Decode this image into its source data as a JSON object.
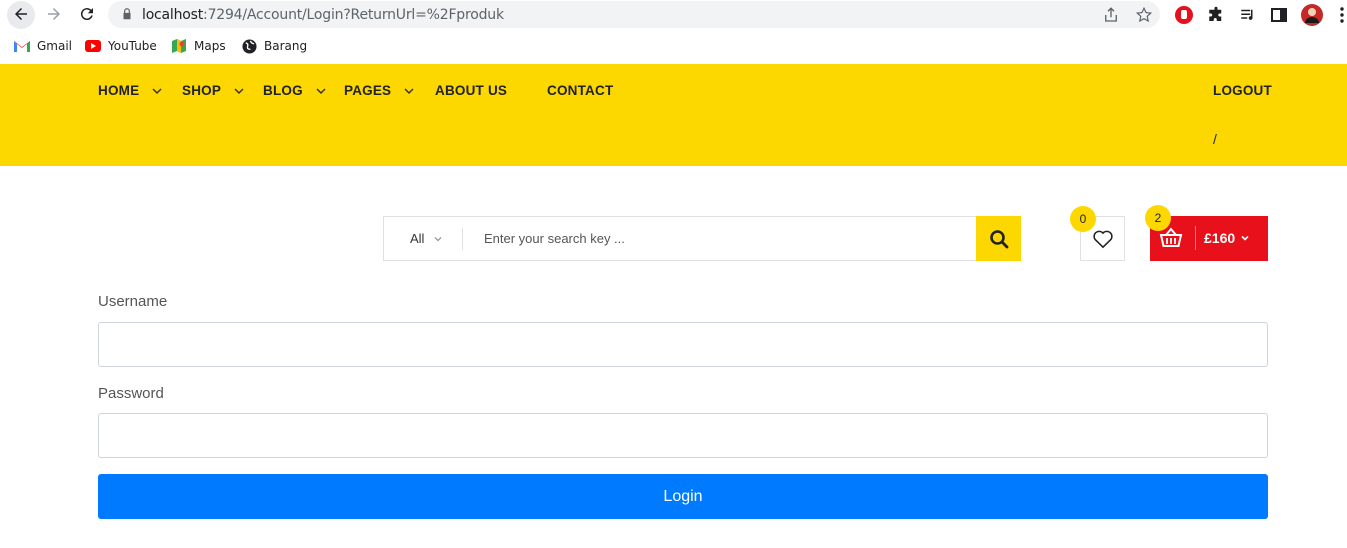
{
  "browser": {
    "url_host": "localhost",
    "url_rest": ":7294/Account/Login?ReturnUrl=%2Fproduk",
    "bookmarks": [
      {
        "label": "Gmail",
        "icon": "gmail-icon"
      },
      {
        "label": "YouTube",
        "icon": "youtube-icon"
      },
      {
        "label": "Maps",
        "icon": "maps-icon"
      },
      {
        "label": "Barang",
        "icon": "globe-icon"
      }
    ]
  },
  "nav": {
    "items": [
      {
        "label": "HOME",
        "dropdown": true
      },
      {
        "label": "SHOP",
        "dropdown": true
      },
      {
        "label": "BLOG",
        "dropdown": true
      },
      {
        "label": "PAGES",
        "dropdown": true
      },
      {
        "label": "ABOUT US",
        "dropdown": false
      },
      {
        "label": "CONTACT",
        "dropdown": false
      }
    ],
    "logout_label": "LOGOUT",
    "slash": "/"
  },
  "search": {
    "category": "All",
    "placeholder": "Enter your search key ..."
  },
  "wishlist": {
    "count": "0"
  },
  "cart": {
    "count": "2",
    "total": "£160"
  },
  "form": {
    "username_label": "Username",
    "password_label": "Password",
    "login_label": "Login"
  },
  "colors": {
    "nav_bg": "#fdd800",
    "cart_bg": "#e8101a",
    "login_bg": "#007bff"
  }
}
